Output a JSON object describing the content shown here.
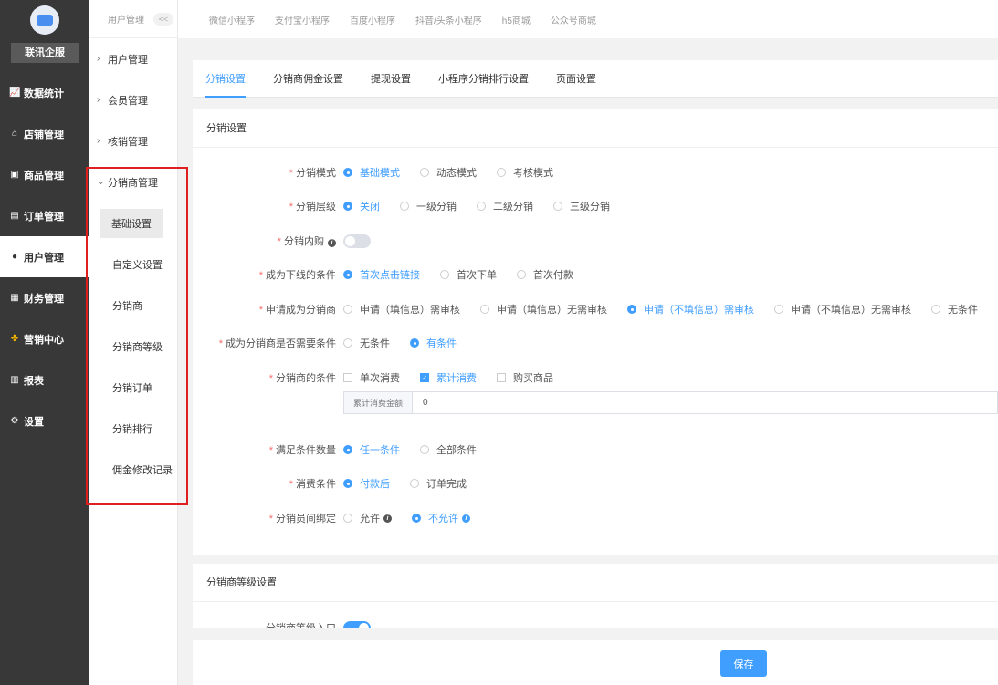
{
  "sidebar": {
    "brand": "联讯企服",
    "items": [
      {
        "label": "数据统计",
        "icon": "chart-icon"
      },
      {
        "label": "店铺管理",
        "icon": "store-icon"
      },
      {
        "label": "商品管理",
        "icon": "goods-icon"
      },
      {
        "label": "订单管理",
        "icon": "order-icon"
      },
      {
        "label": "用户管理",
        "icon": "user-icon",
        "active": true
      },
      {
        "label": "财务管理",
        "icon": "finance-icon"
      },
      {
        "label": "营销中心",
        "icon": "marketing-icon"
      },
      {
        "label": "报表",
        "icon": "report-icon"
      },
      {
        "label": "设置",
        "icon": "settings-icon"
      }
    ]
  },
  "subnav": {
    "title": "用户管理",
    "collapse": "<<",
    "groups": [
      "用户管理",
      "会员管理",
      "核销管理",
      "分销商管理"
    ],
    "items": [
      "基础设置",
      "自定义设置",
      "分销商",
      "分销商等级",
      "分销订单",
      "分销排行",
      "佣金修改记录"
    ]
  },
  "topbar": {
    "tabs": [
      "微信小程序",
      "支付宝小程序",
      "百度小程序",
      "抖音/头条小程序",
      "h5商城",
      "公众号商城"
    ]
  },
  "tabs": [
    "分销设置",
    "分销商佣金设置",
    "提现设置",
    "小程序分销排行设置",
    "页面设置"
  ],
  "settings": {
    "title": "分销设置",
    "mode": {
      "label": "分销模式",
      "options": [
        "基础模式",
        "动态模式",
        "考核模式"
      ],
      "selected": 0
    },
    "level": {
      "label": "分销层级",
      "options": [
        "关闭",
        "一级分销",
        "二级分销",
        "三级分销"
      ],
      "selected": 0
    },
    "internal": {
      "label": "分销内购",
      "enabled": false
    },
    "downline": {
      "label": "成为下线的条件",
      "options": [
        "首次点击链接",
        "首次下单",
        "首次付款"
      ],
      "selected": 0
    },
    "apply": {
      "label": "申请成为分销商",
      "options": [
        "申请（填信息）需审核",
        "申请（填信息）无需审核",
        "申请（不填信息）需审核",
        "申请（不填信息）无需审核",
        "无条件"
      ],
      "selected": 2
    },
    "need_cond": {
      "label": "成为分销商是否需要条件",
      "options": [
        "无条件",
        "有条件"
      ],
      "selected": 1
    },
    "conditions": {
      "label": "分销商的条件",
      "options": [
        "单次消费",
        "累计消费",
        "购买商品"
      ],
      "checked": [
        false,
        true,
        false
      ]
    },
    "amount": {
      "addon": "累计消费金额",
      "value": "0"
    },
    "satisfy": {
      "label": "满足条件数量",
      "options": [
        "任一条件",
        "全部条件"
      ],
      "selected": 0
    },
    "consume": {
      "label": "消费条件",
      "options": [
        "付款后",
        "订单完成"
      ],
      "selected": 0
    },
    "binding": {
      "label": "分销员间绑定",
      "options": [
        "允许",
        "不允许"
      ],
      "selected": 1
    }
  },
  "level_settings": {
    "title": "分销商等级设置",
    "entry_label": "分销商等级入口",
    "enabled": true
  },
  "footer": {
    "save": "保存"
  },
  "colors": {
    "accent": "#409eff",
    "sidebar": "#383838",
    "required": "#f56c6c",
    "highlight": "#e02020"
  }
}
